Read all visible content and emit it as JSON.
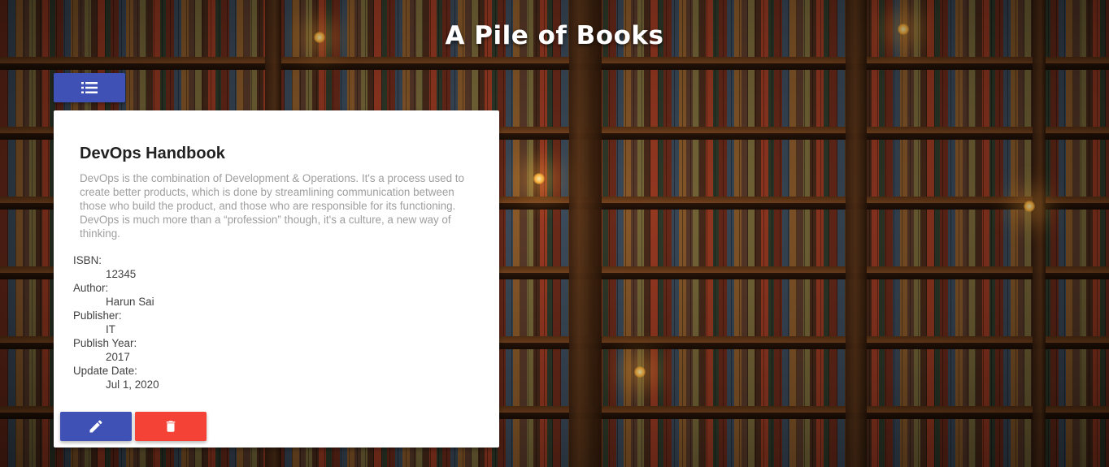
{
  "header": {
    "title": "A Pile of Books"
  },
  "toolbar": {
    "list_icon": "list-icon"
  },
  "book": {
    "title": "DevOps Handbook",
    "description": "DevOps is the combination of Development & Operations. It's a process used to create better products, which is done by streamlining communication between those who build the product, and those who are responsible for its functioning. DevOps is much more than a “profession” though, it's a culture, a new way of thinking.",
    "fields": [
      {
        "label": "ISBN:",
        "value": "12345"
      },
      {
        "label": "Author:",
        "value": "Harun Sai"
      },
      {
        "label": "Publisher:",
        "value": "IT"
      },
      {
        "label": "Publish Year:",
        "value": "2017"
      },
      {
        "label": "Update Date:",
        "value": "Jul 1, 2020"
      }
    ]
  },
  "actions": {
    "edit_icon": "edit-icon",
    "delete_icon": "delete-icon"
  },
  "colors": {
    "primary": "#3f51b5",
    "danger": "#f44336",
    "card_background": "#ffffff",
    "description_text": "#9e9e9e"
  }
}
